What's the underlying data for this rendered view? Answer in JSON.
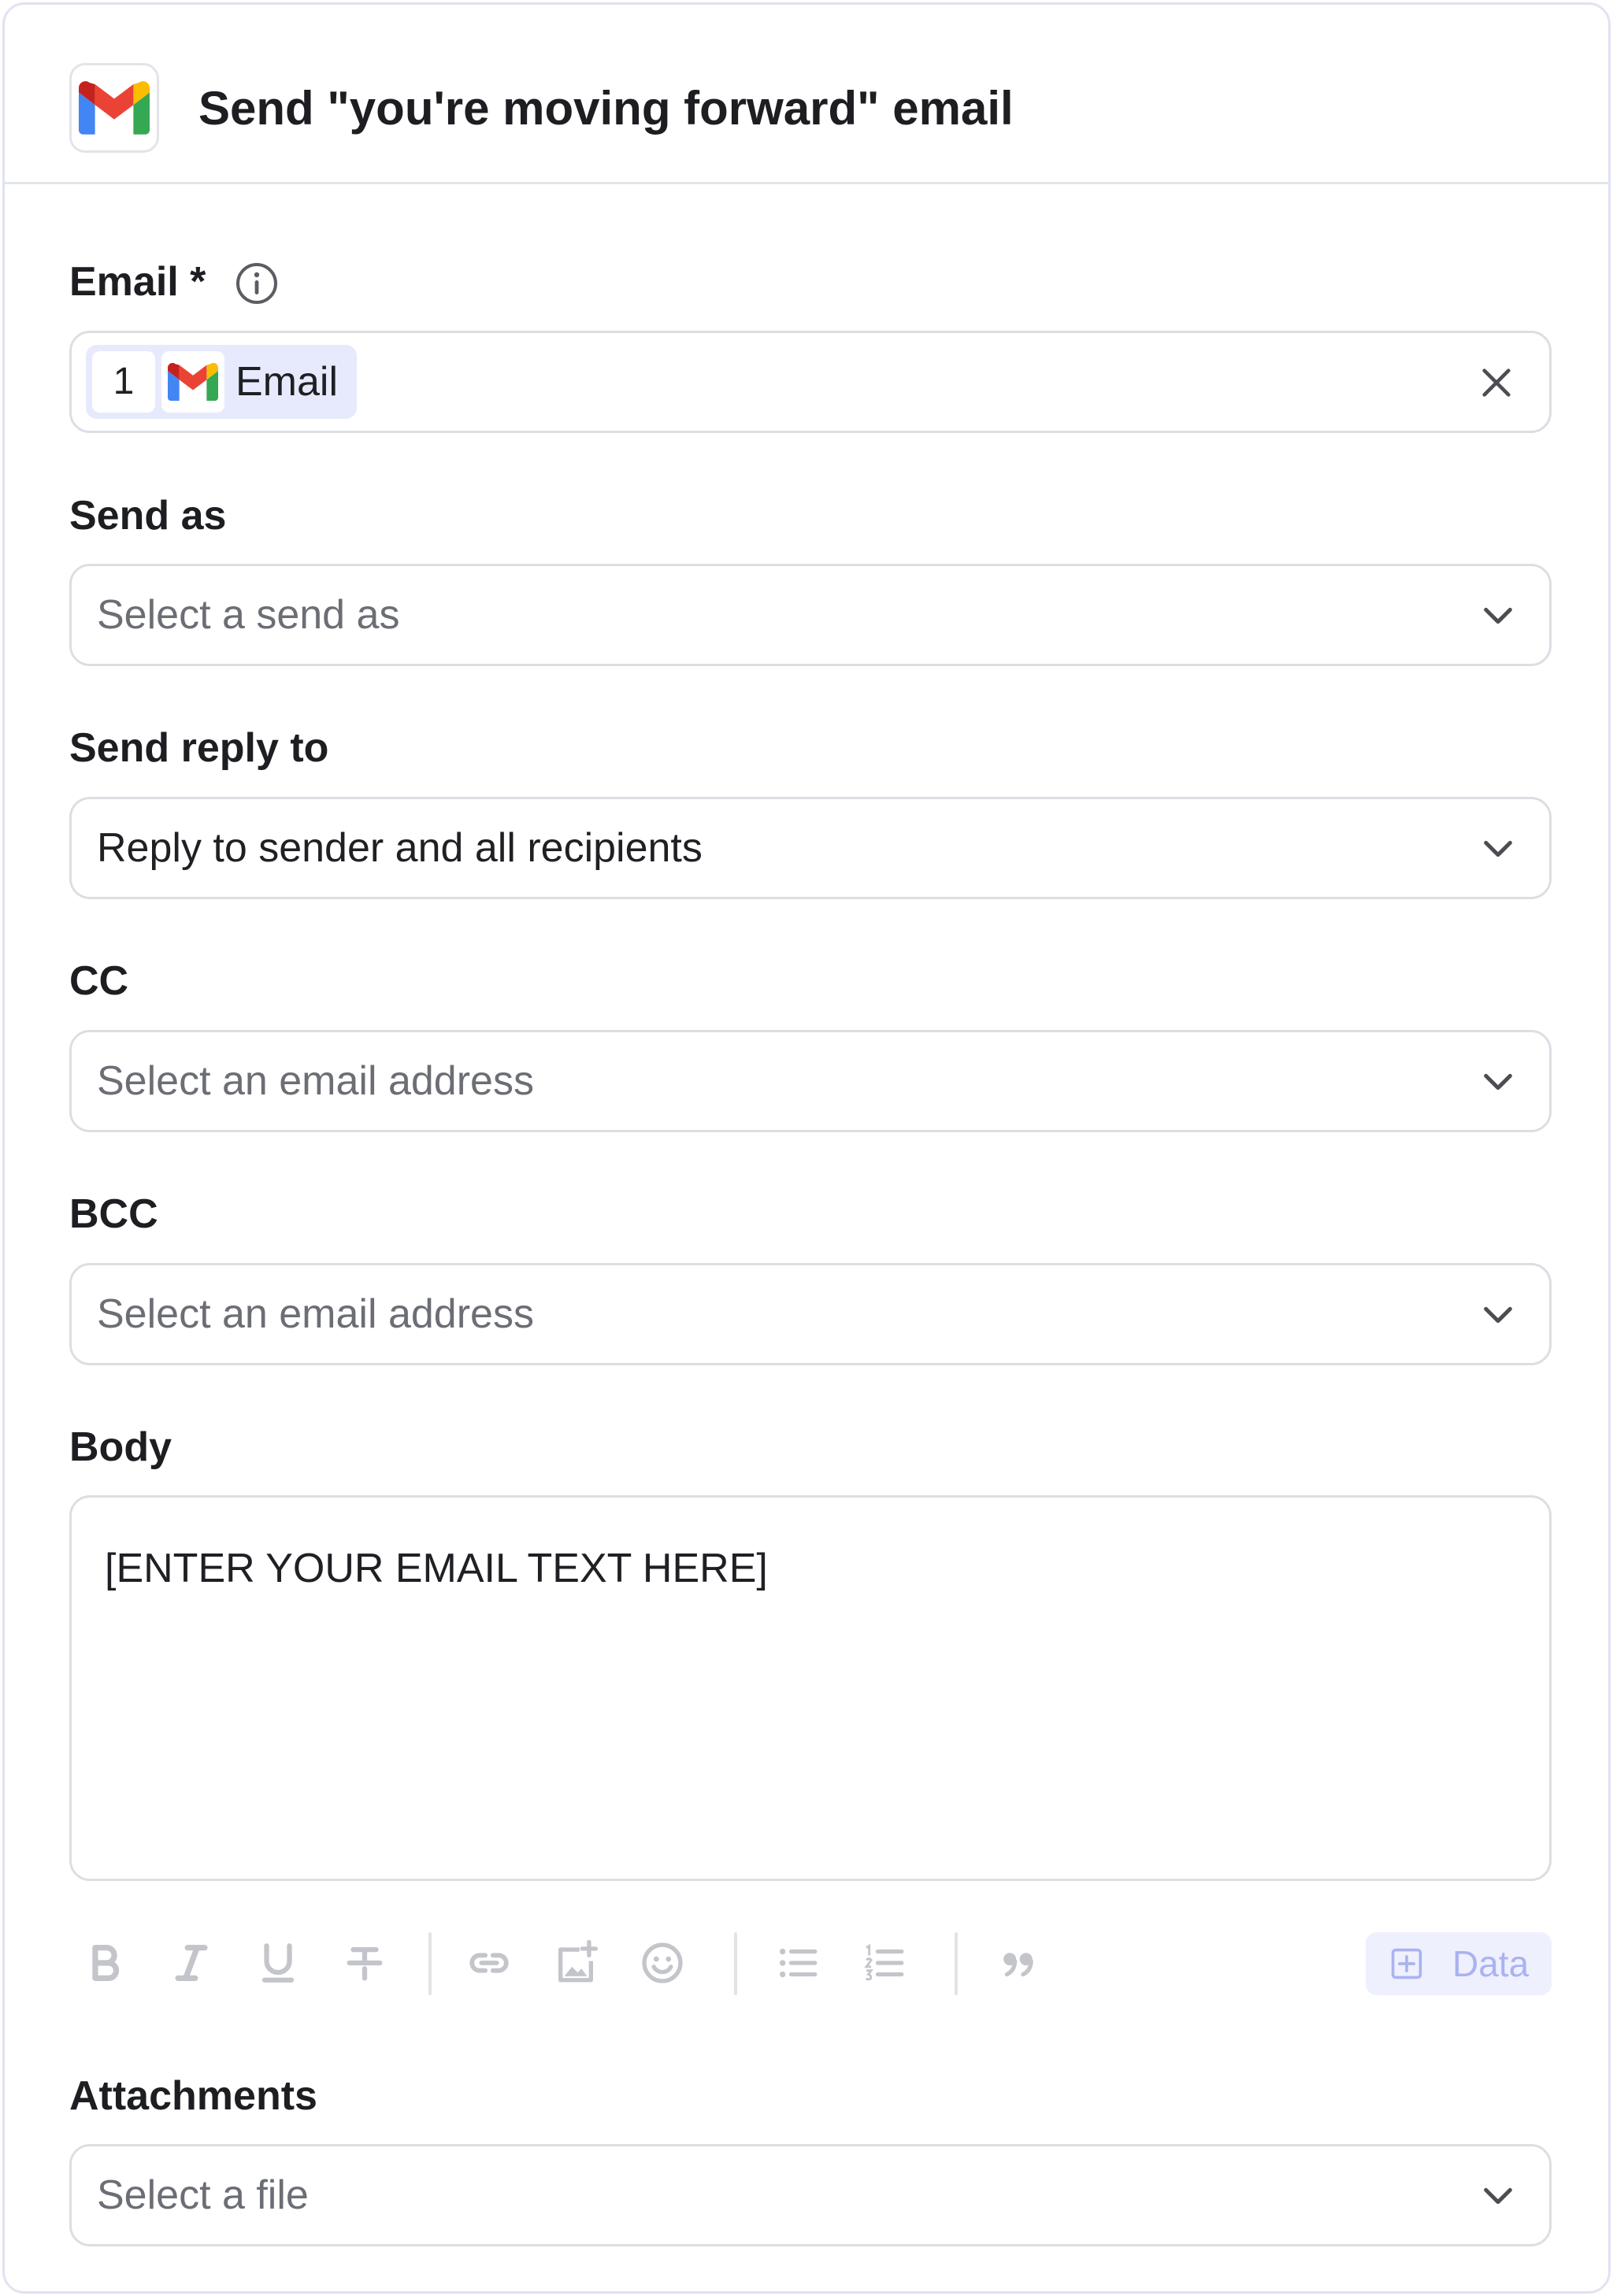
{
  "header": {
    "title": "Send \"you're moving forward\" email",
    "app_icon": "gmail-logo"
  },
  "fields": {
    "email": {
      "label": "Email *",
      "chip_step": "1",
      "chip_label": "Email",
      "chip_icon": "gmail-logo"
    },
    "send_as": {
      "label": "Send as",
      "placeholder": "Select a send as"
    },
    "send_reply_to": {
      "label": "Send reply to",
      "value": "Reply to sender and all recipients"
    },
    "cc": {
      "label": "CC",
      "placeholder": "Select an email address"
    },
    "bcc": {
      "label": "BCC",
      "placeholder": "Select an email address"
    },
    "body": {
      "label": "Body",
      "value": "[ENTER YOUR EMAIL TEXT HERE]"
    },
    "attachments": {
      "label": "Attachments",
      "placeholder": "Select a file"
    }
  },
  "toolbar": {
    "buttons": [
      "bold-icon",
      "italic-icon",
      "underline-icon",
      "strikethrough-icon",
      "link-icon",
      "add-image-icon",
      "emoji-icon",
      "bulleted-list-icon",
      "numbered-list-icon",
      "quote-icon"
    ],
    "data_label": "Data"
  },
  "colors": {
    "border": "#dcdee3",
    "card_border": "#dfe3f2",
    "chip_bg": "#e7eafc",
    "data_button_bg": "#eef0fd",
    "data_button_text": "#aab3f0",
    "toolbar_icon": "#c3c5cb"
  }
}
